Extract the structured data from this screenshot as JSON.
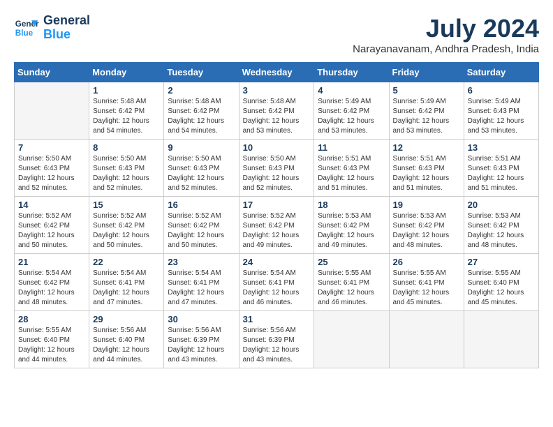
{
  "header": {
    "logo_line1": "General",
    "logo_line2": "Blue",
    "month_year": "July 2024",
    "location": "Narayanavanam, Andhra Pradesh, India"
  },
  "days_of_week": [
    "Sunday",
    "Monday",
    "Tuesday",
    "Wednesday",
    "Thursday",
    "Friday",
    "Saturday"
  ],
  "weeks": [
    [
      {
        "day": "",
        "info": ""
      },
      {
        "day": "1",
        "info": "Sunrise: 5:48 AM\nSunset: 6:42 PM\nDaylight: 12 hours\nand 54 minutes."
      },
      {
        "day": "2",
        "info": "Sunrise: 5:48 AM\nSunset: 6:42 PM\nDaylight: 12 hours\nand 54 minutes."
      },
      {
        "day": "3",
        "info": "Sunrise: 5:48 AM\nSunset: 6:42 PM\nDaylight: 12 hours\nand 53 minutes."
      },
      {
        "day": "4",
        "info": "Sunrise: 5:49 AM\nSunset: 6:42 PM\nDaylight: 12 hours\nand 53 minutes."
      },
      {
        "day": "5",
        "info": "Sunrise: 5:49 AM\nSunset: 6:42 PM\nDaylight: 12 hours\nand 53 minutes."
      },
      {
        "day": "6",
        "info": "Sunrise: 5:49 AM\nSunset: 6:43 PM\nDaylight: 12 hours\nand 53 minutes."
      }
    ],
    [
      {
        "day": "7",
        "info": "Sunrise: 5:50 AM\nSunset: 6:43 PM\nDaylight: 12 hours\nand 52 minutes."
      },
      {
        "day": "8",
        "info": "Sunrise: 5:50 AM\nSunset: 6:43 PM\nDaylight: 12 hours\nand 52 minutes."
      },
      {
        "day": "9",
        "info": "Sunrise: 5:50 AM\nSunset: 6:43 PM\nDaylight: 12 hours\nand 52 minutes."
      },
      {
        "day": "10",
        "info": "Sunrise: 5:50 AM\nSunset: 6:43 PM\nDaylight: 12 hours\nand 52 minutes."
      },
      {
        "day": "11",
        "info": "Sunrise: 5:51 AM\nSunset: 6:43 PM\nDaylight: 12 hours\nand 51 minutes."
      },
      {
        "day": "12",
        "info": "Sunrise: 5:51 AM\nSunset: 6:43 PM\nDaylight: 12 hours\nand 51 minutes."
      },
      {
        "day": "13",
        "info": "Sunrise: 5:51 AM\nSunset: 6:43 PM\nDaylight: 12 hours\nand 51 minutes."
      }
    ],
    [
      {
        "day": "14",
        "info": "Sunrise: 5:52 AM\nSunset: 6:42 PM\nDaylight: 12 hours\nand 50 minutes."
      },
      {
        "day": "15",
        "info": "Sunrise: 5:52 AM\nSunset: 6:42 PM\nDaylight: 12 hours\nand 50 minutes."
      },
      {
        "day": "16",
        "info": "Sunrise: 5:52 AM\nSunset: 6:42 PM\nDaylight: 12 hours\nand 50 minutes."
      },
      {
        "day": "17",
        "info": "Sunrise: 5:52 AM\nSunset: 6:42 PM\nDaylight: 12 hours\nand 49 minutes."
      },
      {
        "day": "18",
        "info": "Sunrise: 5:53 AM\nSunset: 6:42 PM\nDaylight: 12 hours\nand 49 minutes."
      },
      {
        "day": "19",
        "info": "Sunrise: 5:53 AM\nSunset: 6:42 PM\nDaylight: 12 hours\nand 48 minutes."
      },
      {
        "day": "20",
        "info": "Sunrise: 5:53 AM\nSunset: 6:42 PM\nDaylight: 12 hours\nand 48 minutes."
      }
    ],
    [
      {
        "day": "21",
        "info": "Sunrise: 5:54 AM\nSunset: 6:42 PM\nDaylight: 12 hours\nand 48 minutes."
      },
      {
        "day": "22",
        "info": "Sunrise: 5:54 AM\nSunset: 6:41 PM\nDaylight: 12 hours\nand 47 minutes."
      },
      {
        "day": "23",
        "info": "Sunrise: 5:54 AM\nSunset: 6:41 PM\nDaylight: 12 hours\nand 47 minutes."
      },
      {
        "day": "24",
        "info": "Sunrise: 5:54 AM\nSunset: 6:41 PM\nDaylight: 12 hours\nand 46 minutes."
      },
      {
        "day": "25",
        "info": "Sunrise: 5:55 AM\nSunset: 6:41 PM\nDaylight: 12 hours\nand 46 minutes."
      },
      {
        "day": "26",
        "info": "Sunrise: 5:55 AM\nSunset: 6:41 PM\nDaylight: 12 hours\nand 45 minutes."
      },
      {
        "day": "27",
        "info": "Sunrise: 5:55 AM\nSunset: 6:40 PM\nDaylight: 12 hours\nand 45 minutes."
      }
    ],
    [
      {
        "day": "28",
        "info": "Sunrise: 5:55 AM\nSunset: 6:40 PM\nDaylight: 12 hours\nand 44 minutes."
      },
      {
        "day": "29",
        "info": "Sunrise: 5:56 AM\nSunset: 6:40 PM\nDaylight: 12 hours\nand 44 minutes."
      },
      {
        "day": "30",
        "info": "Sunrise: 5:56 AM\nSunset: 6:39 PM\nDaylight: 12 hours\nand 43 minutes."
      },
      {
        "day": "31",
        "info": "Sunrise: 5:56 AM\nSunset: 6:39 PM\nDaylight: 12 hours\nand 43 minutes."
      },
      {
        "day": "",
        "info": ""
      },
      {
        "day": "",
        "info": ""
      },
      {
        "day": "",
        "info": ""
      }
    ]
  ]
}
